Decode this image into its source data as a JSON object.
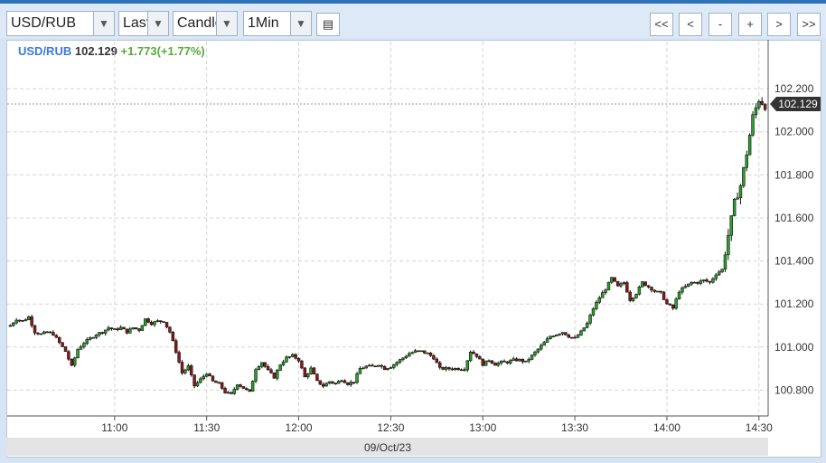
{
  "toolbar": {
    "symbol": "USD/RUB",
    "price_field": "Last",
    "chart_type": "Candle",
    "interval": "1Min",
    "nav": [
      "<<",
      "<",
      "-",
      "+",
      ">",
      ">>"
    ]
  },
  "header": {
    "symbol": "USD/RUB",
    "last": "102.129",
    "change": "+1.773(+1.77%)",
    "symbol_color": "#3a7bd5",
    "change_color": "#5aaa3c"
  },
  "colors": {
    "up": "#2ca02c",
    "down": "#8b1a1a",
    "wick": "#111111",
    "grid": "#d5d5d5"
  },
  "chart_data": {
    "type": "candlestick",
    "title": "",
    "xlabel": "",
    "ylabel": "",
    "x_ticks": [
      "11:00",
      "11:30",
      "12:00",
      "12:30",
      "13:00",
      "13:30",
      "14:00",
      "14:30"
    ],
    "y_ticks": [
      "100.800",
      "101.000",
      "101.200",
      "101.400",
      "101.600",
      "101.800",
      "102.000",
      "102.200"
    ],
    "date_label": "09/Oct/23",
    "last_price_label": "102.129",
    "ylim": [
      100.68,
      102.36
    ],
    "x_range_minutes_since_1030": [
      -5,
      243
    ],
    "grid": true,
    "price_path": [
      [
        -4,
        101.1
      ],
      [
        -2,
        101.13
      ],
      [
        0,
        101.12
      ],
      [
        2,
        101.14
      ],
      [
        4,
        101.07
      ],
      [
        6,
        101.06
      ],
      [
        8,
        101.07
      ],
      [
        10,
        101.06
      ],
      [
        12,
        101.02
      ],
      [
        14,
        100.98
      ],
      [
        16,
        100.91
      ],
      [
        18,
        100.99
      ],
      [
        20,
        101.02
      ],
      [
        22,
        101.04
      ],
      [
        24,
        101.06
      ],
      [
        26,
        101.07
      ],
      [
        28,
        101.09
      ],
      [
        30,
        101.08
      ],
      [
        32,
        101.09
      ],
      [
        34,
        101.07
      ],
      [
        36,
        101.09
      ],
      [
        38,
        101.08
      ],
      [
        40,
        101.13
      ],
      [
        42,
        101.11
      ],
      [
        44,
        101.12
      ],
      [
        46,
        101.12
      ],
      [
        48,
        101.07
      ],
      [
        50,
        100.98
      ],
      [
        52,
        100.88
      ],
      [
        54,
        100.91
      ],
      [
        56,
        100.82
      ],
      [
        58,
        100.85
      ],
      [
        60,
        100.88
      ],
      [
        62,
        100.84
      ],
      [
        64,
        100.83
      ],
      [
        66,
        100.79
      ],
      [
        68,
        100.78
      ],
      [
        70,
        100.83
      ],
      [
        72,
        100.81
      ],
      [
        74,
        100.79
      ],
      [
        76,
        100.9
      ],
      [
        78,
        100.93
      ],
      [
        80,
        100.89
      ],
      [
        82,
        100.86
      ],
      [
        84,
        100.92
      ],
      [
        86,
        100.95
      ],
      [
        88,
        100.96
      ],
      [
        90,
        100.94
      ],
      [
        92,
        100.86
      ],
      [
        94,
        100.9
      ],
      [
        96,
        100.84
      ],
      [
        98,
        100.82
      ],
      [
        100,
        100.84
      ],
      [
        102,
        100.83
      ],
      [
        104,
        100.85
      ],
      [
        106,
        100.83
      ],
      [
        108,
        100.84
      ],
      [
        110,
        100.9
      ],
      [
        112,
        100.91
      ],
      [
        114,
        100.91
      ],
      [
        116,
        100.92
      ],
      [
        118,
        100.9
      ],
      [
        120,
        100.91
      ],
      [
        122,
        100.93
      ],
      [
        124,
        100.95
      ],
      [
        126,
        100.97
      ],
      [
        128,
        100.98
      ],
      [
        130,
        100.98
      ],
      [
        132,
        100.97
      ],
      [
        134,
        100.95
      ],
      [
        136,
        100.9
      ],
      [
        138,
        100.9
      ],
      [
        140,
        100.9
      ],
      [
        142,
        100.9
      ],
      [
        144,
        100.9
      ],
      [
        146,
        100.98
      ],
      [
        148,
        100.96
      ],
      [
        150,
        100.92
      ],
      [
        152,
        100.94
      ],
      [
        154,
        100.92
      ],
      [
        156,
        100.93
      ],
      [
        158,
        100.93
      ],
      [
        160,
        100.94
      ],
      [
        162,
        100.94
      ],
      [
        164,
        100.93
      ],
      [
        166,
        100.96
      ],
      [
        168,
        100.99
      ],
      [
        170,
        101.02
      ],
      [
        172,
        101.05
      ],
      [
        174,
        101.06
      ],
      [
        176,
        101.07
      ],
      [
        178,
        101.05
      ],
      [
        180,
        101.04
      ],
      [
        182,
        101.07
      ],
      [
        184,
        101.11
      ],
      [
        186,
        101.18
      ],
      [
        188,
        101.23
      ],
      [
        190,
        101.27
      ],
      [
        192,
        101.32
      ],
      [
        194,
        101.28
      ],
      [
        196,
        101.3
      ],
      [
        198,
        101.22
      ],
      [
        200,
        101.25
      ],
      [
        202,
        101.3
      ],
      [
        204,
        101.28
      ],
      [
        206,
        101.26
      ],
      [
        208,
        101.25
      ],
      [
        210,
        101.2
      ],
      [
        212,
        101.18
      ],
      [
        214,
        101.26
      ],
      [
        216,
        101.28
      ],
      [
        218,
        101.3
      ],
      [
        220,
        101.3
      ],
      [
        222,
        101.31
      ],
      [
        224,
        101.3
      ],
      [
        226,
        101.34
      ],
      [
        228,
        101.36
      ],
      [
        230,
        101.52
      ],
      [
        232,
        101.67
      ],
      [
        234,
        101.75
      ],
      [
        236,
        101.9
      ],
      [
        238,
        102.07
      ],
      [
        240,
        102.15
      ],
      [
        242,
        102.12
      ]
    ]
  }
}
